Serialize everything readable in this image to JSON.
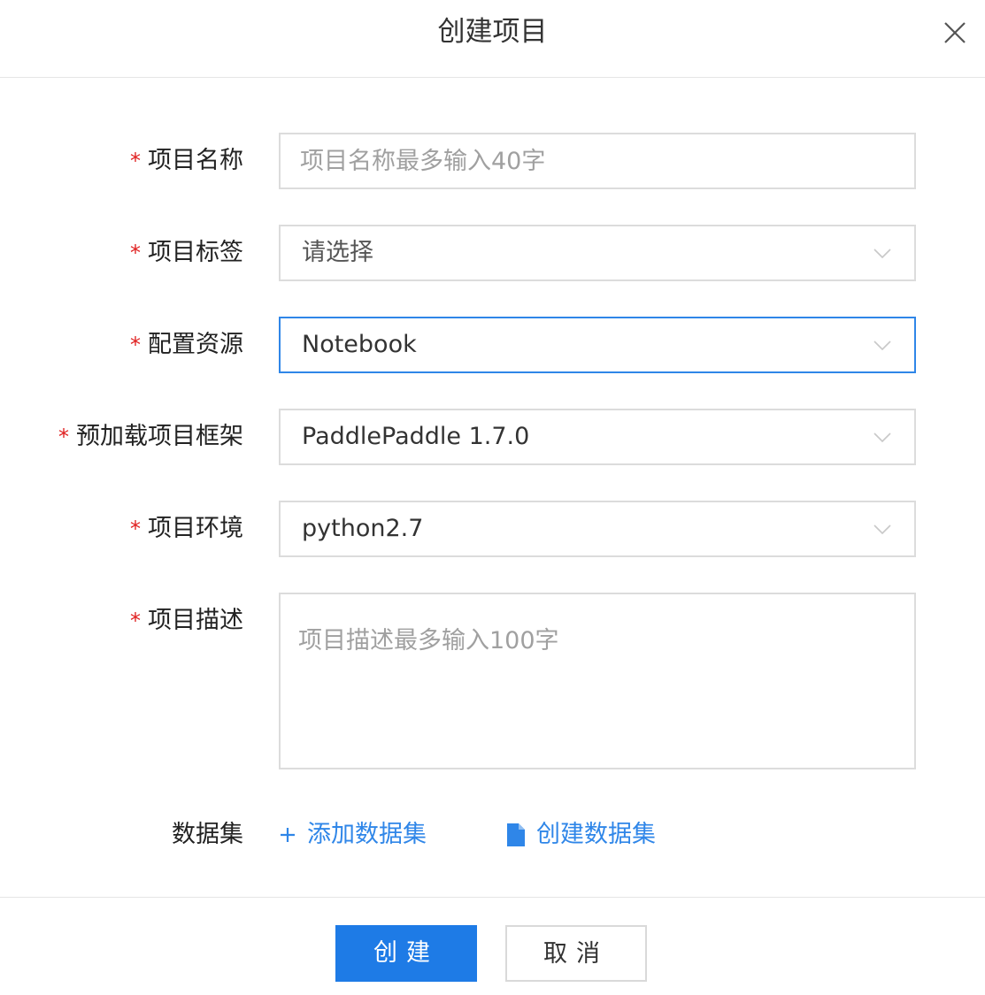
{
  "dialog": {
    "title": "创建项目",
    "close_icon": "close-icon"
  },
  "form": {
    "required_mark": "*",
    "name": {
      "label": "项目名称",
      "placeholder": "项目名称最多输入40字",
      "value": ""
    },
    "tags": {
      "label": "项目标签",
      "value": "请选择"
    },
    "resource": {
      "label": "配置资源",
      "value": "Notebook"
    },
    "framework": {
      "label": "预加载项目框架",
      "value": "PaddlePaddle 1.7.0"
    },
    "environment": {
      "label": "项目环境",
      "value": "python2.7"
    },
    "description": {
      "label": "项目描述",
      "placeholder": "项目描述最多输入100字",
      "value": ""
    },
    "dataset": {
      "label": "数据集",
      "add_link": "添加数据集",
      "create_link": "创建数据集"
    }
  },
  "footer": {
    "create_button": "创建",
    "cancel_button": "取消"
  },
  "colors": {
    "accent": "#1e7be6",
    "link": "#2f86e8",
    "required": "#e02020",
    "border": "#dcdcdc"
  }
}
